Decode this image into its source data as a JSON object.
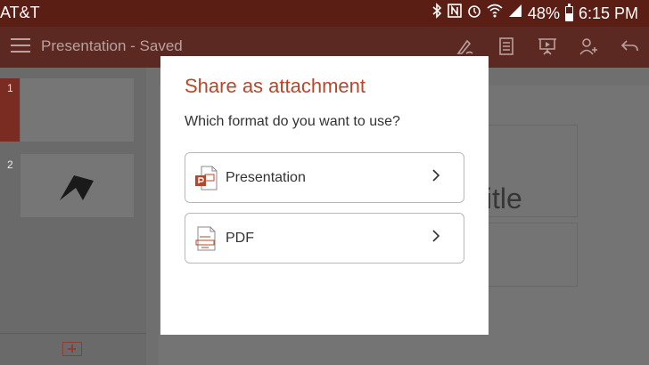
{
  "status_bar": {
    "carrier": "AT&T",
    "battery": "48%",
    "battery_level": 0.48,
    "time": "6:15 PM",
    "icons": [
      "bluetooth-icon",
      "nfc-icon",
      "alarm-icon",
      "wifi-icon",
      "signal-icon",
      "battery-icon"
    ]
  },
  "toolbar": {
    "title": "Presentation - Saved",
    "icons": [
      "menu-icon",
      "draw-icon",
      "notes-icon",
      "present-icon",
      "share-person-icon",
      "undo-icon"
    ]
  },
  "sidebar": {
    "slides": [
      {
        "number": "1"
      },
      {
        "number": "2"
      }
    ],
    "add_slide_icon": "add-slide-icon"
  },
  "canvas": {
    "visible_text": "title"
  },
  "dialog": {
    "title": "Share as attachment",
    "question": "Which format do you want to use?",
    "options": [
      {
        "label": "Presentation",
        "icon": "powerpoint-file-icon"
      },
      {
        "label": "PDF",
        "icon": "pdf-file-icon"
      }
    ]
  },
  "colors": {
    "accent": "#b7472a",
    "status_bar": "#5a1e15",
    "toolbar_dim": "#5b2822"
  }
}
